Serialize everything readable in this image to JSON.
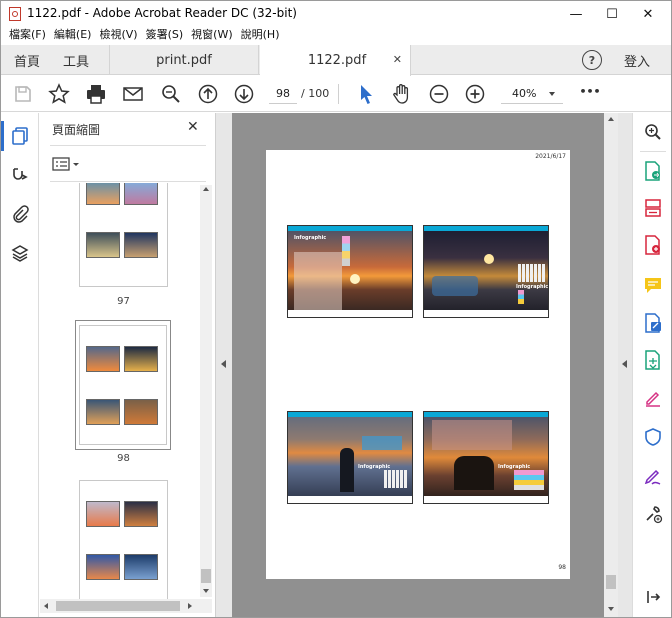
{
  "window": {
    "title": "1122.pdf - Adobe Acrobat Reader DC (32-bit)",
    "minimize": "—",
    "maximize": "☐",
    "close": "✕"
  },
  "menu": [
    "檔案(F)",
    "編輯(E)",
    "檢視(V)",
    "簽署(S)",
    "視窗(W)",
    "說明(H)"
  ],
  "tabs": {
    "home": "首頁",
    "tools": "工具",
    "doc1": "print.pdf",
    "doc2": "1122.pdf",
    "doc2_close": "✕",
    "help": "?",
    "login": "登入"
  },
  "toolbar": {
    "page_current": "98",
    "page_total": "/ 100",
    "zoom": "40%",
    "more": "•••"
  },
  "thumbnails": {
    "panel_title": "頁面縮圖",
    "close": "✕",
    "pages": [
      {
        "label": "97"
      },
      {
        "label": "98"
      },
      {
        "label": ""
      }
    ]
  },
  "page": {
    "date": "2021/6/17",
    "number": "98",
    "infographic": "Infographic"
  },
  "colors": {
    "accent_blue": "#2d6ecb",
    "tool_red": "#d7263d",
    "tool_purple": "#7b2cbf",
    "slide_header": "#0aa8d6"
  }
}
